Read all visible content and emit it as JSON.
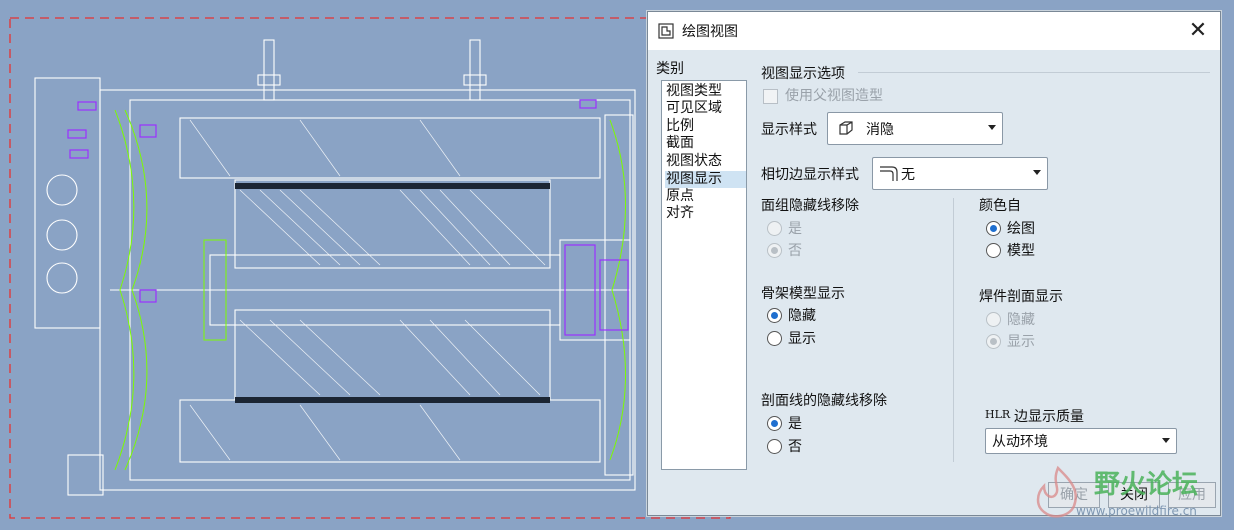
{
  "dialog": {
    "title": "绘图视图",
    "close_glyph": "✕",
    "category_label": "类别",
    "categories": [
      "视图类型",
      "可见区域",
      "比例",
      "截面",
      "视图状态",
      "视图显示",
      "原点",
      "对齐"
    ],
    "selected_category": "视图显示",
    "options_title": "视图显示选项",
    "use_parent_view_style": {
      "label": "使用父视图造型",
      "checked": false,
      "enabled": false
    },
    "display_style": {
      "label": "显示样式",
      "value": "消隐"
    },
    "tangent_edge_style": {
      "label": "相切边显示样式",
      "value": "无"
    },
    "face_group_hidden_line_removal": {
      "label": "面组隐藏线移除",
      "options": [
        "是",
        "否"
      ],
      "selected": "否",
      "enabled": false
    },
    "color_from": {
      "label": "颜色自",
      "options": [
        "绘图",
        "模型"
      ],
      "selected": "绘图"
    },
    "skeleton_model_display": {
      "label": "骨架模型显示",
      "options": [
        "隐藏",
        "显示"
      ],
      "selected": "隐藏"
    },
    "weld_section_display": {
      "label": "焊件剖面显示",
      "options": [
        "隐藏",
        "显示"
      ],
      "selected": "显示",
      "enabled": false
    },
    "section_line_hidden_line_removal": {
      "label": "剖面线的隐藏线移除",
      "options": [
        "是",
        "否"
      ],
      "selected": "是"
    },
    "hlr_edge_quality": {
      "label_prefix": "HLR",
      "label": "边显示质量",
      "value": "从动环境"
    },
    "buttons": {
      "ok": "确定",
      "close": "关闭",
      "apply": "应用"
    }
  },
  "watermark": {
    "text": "野火论坛",
    "url": "www.proewildfire.cn"
  },
  "colors": {
    "drawing_bg": "#8aa3c5",
    "drawing_line": "#ffffff",
    "accent_green": "#7CFC00",
    "accent_purple": "#9b30ff",
    "sheet_border": "#e53333"
  }
}
